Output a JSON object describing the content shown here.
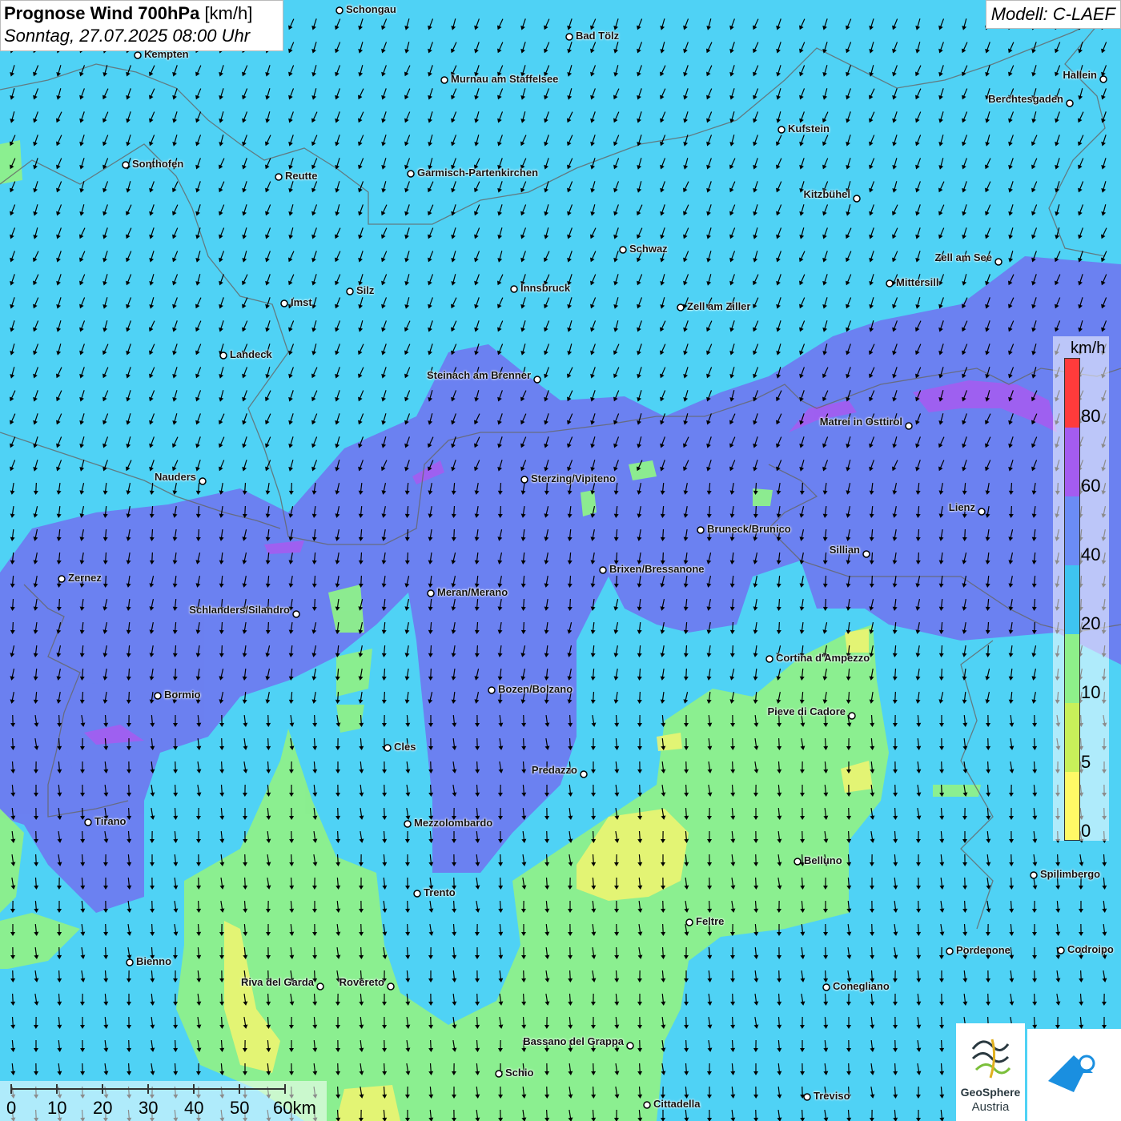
{
  "header": {
    "title_bold": "Prognose Wind 700hPa",
    "title_unit": "[km/h]",
    "subtitle": "Sonntag, 27.07.2025 08:00 Uhr",
    "model": "Modell: C-LAEF"
  },
  "legend": {
    "unit": "km/h",
    "labels": [
      "80",
      "60",
      "40",
      "20",
      "10",
      "5",
      "0"
    ],
    "colors": {
      "c80": "#ff3b3b",
      "c60": "#a45cf0",
      "c40": "#6b8cf5",
      "c20": "#3ec4f0",
      "c10": "#8ef08a",
      "c5": "#c8f05a",
      "c0": "#fff966"
    }
  },
  "scalebar": {
    "labels": [
      "0",
      "10",
      "20",
      "30",
      "40",
      "50",
      "60km"
    ]
  },
  "logos": {
    "geosphere_line1": "GeoSphere",
    "geosphere_line2": "Austria",
    "geosphere_icon": "geosphere-icon",
    "weather_icon": "cloud-arrow-icon"
  },
  "map": {
    "field_colors": {
      "ocean_blue": "#4fd2f5",
      "violet": "#6d7cf0",
      "green": "#8ef08a",
      "yellow": "#f2f570"
    },
    "arrow_glyph": "wind-arrow-icon",
    "cities": [
      "Schongau",
      "Bad Tölz",
      "Kempten",
      "Murnau am Staffelsee",
      "Hallein",
      "Berchtesgaden",
      "Kufstein",
      "Sonthofen",
      "Reutte",
      "Garmisch-Partenkirchen",
      "Kitzbühel",
      "Schwaz",
      "Zell am See",
      "Mittersill",
      "Silz",
      "Innsbruck",
      "Imst",
      "Zell am Ziller",
      "Landeck",
      "Steinach am Brenner",
      "Matrei in Osttirol",
      "Nauders",
      "Sterzing/Vipiteno",
      "Lienz",
      "Bruneck/Brunico",
      "Sillian",
      "Zernez",
      "Brixen/Bressanone",
      "Meran/Merano",
      "Schlanders/Silandro",
      "Cortina d'Ampezzo",
      "Bormio",
      "Bozen/Bolzano",
      "Pieve di Cadore",
      "Cles",
      "Predazzo",
      "Tirano",
      "Mezzolombardo",
      "Belluno",
      "Spilimbergo",
      "Trento",
      "Feltre",
      "Bienno",
      "Pordenone",
      "Codroipo",
      "Riva del Garda",
      "Rovereto",
      "Conegliano",
      "Bassano del Grappa",
      "Schio",
      "Treviso",
      "Cittadella"
    ]
  }
}
